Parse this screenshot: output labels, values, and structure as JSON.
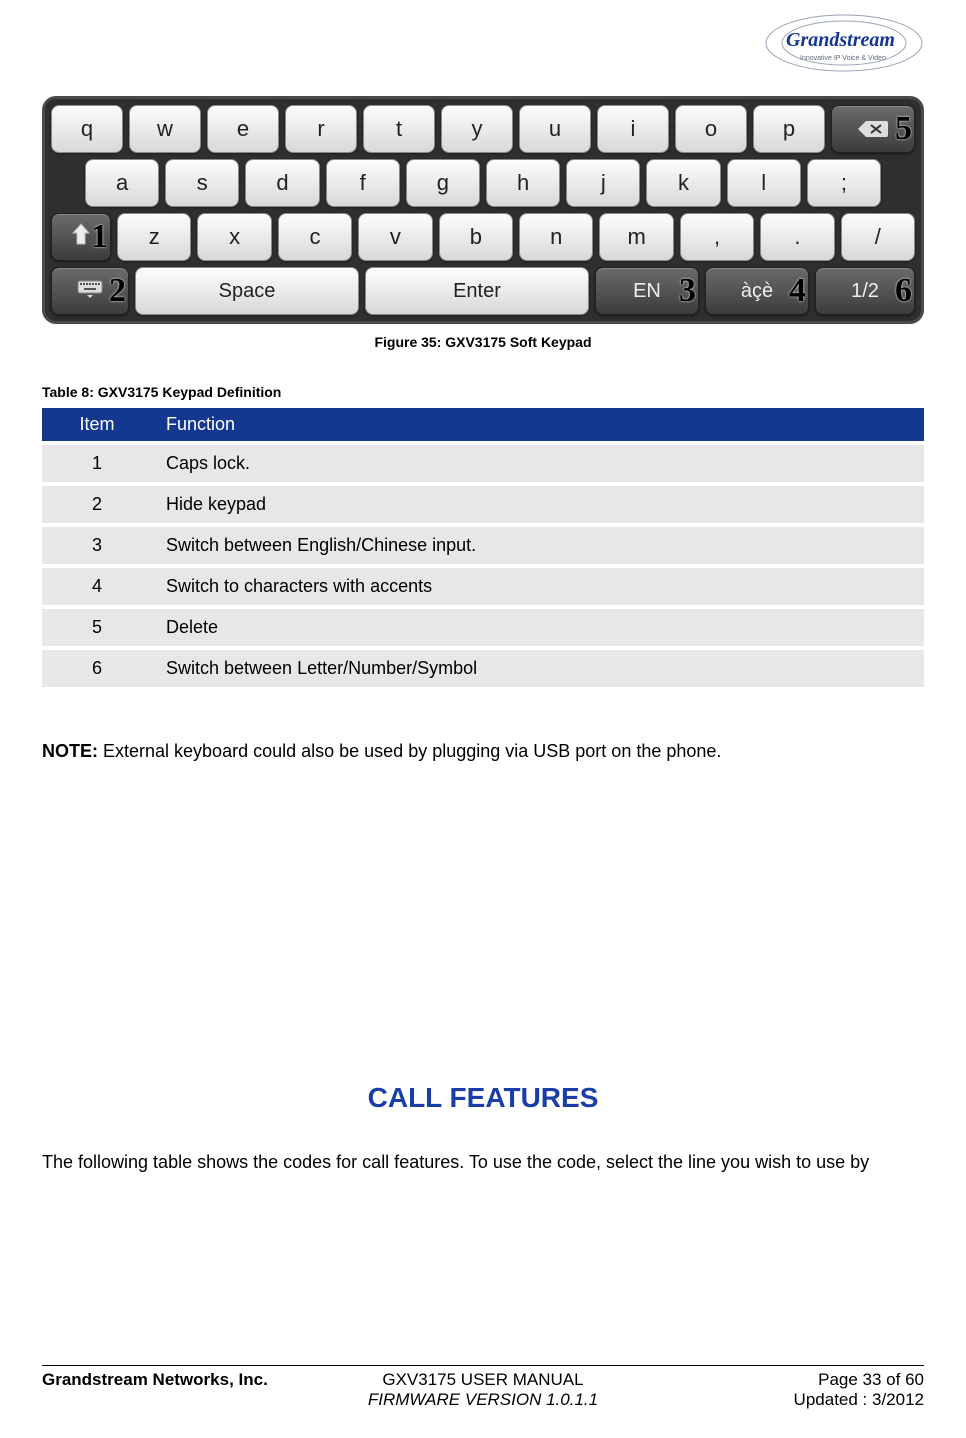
{
  "logo": {
    "brand": "Grandstream",
    "tagline": "Innovative IP Voice & Video"
  },
  "keypad": {
    "row1": [
      "q",
      "w",
      "e",
      "r",
      "t",
      "y",
      "u",
      "i",
      "o",
      "p"
    ],
    "row2": [
      "a",
      "s",
      "d",
      "f",
      "g",
      "h",
      "j",
      "k",
      "l",
      ";"
    ],
    "row3": [
      "z",
      "x",
      "c",
      "v",
      "b",
      "n",
      "m",
      ",",
      ".",
      "/"
    ],
    "space": "Space",
    "enter": "Enter",
    "en": "EN",
    "accents": "àçè",
    "mode": "1/2",
    "badges": {
      "shift": "1",
      "hide": "2",
      "en": "3",
      "accents": "4",
      "backspace": "5",
      "mode": "6"
    }
  },
  "figure_caption": "Figure 35: GXV3175 Soft Keypad",
  "table_caption": "Table 8: GXV3175 Keypad Definition",
  "table": {
    "headers": {
      "item": "Item",
      "function": "Function"
    },
    "rows": [
      {
        "item": "1",
        "function": "Caps lock."
      },
      {
        "item": "2",
        "function": "Hide keypad"
      },
      {
        "item": "3",
        "function": "Switch between English/Chinese input."
      },
      {
        "item": "4",
        "function": "Switch to characters with accents"
      },
      {
        "item": "5",
        "function": "Delete"
      },
      {
        "item": "6",
        "function": "Switch between Letter/Number/Symbol"
      }
    ]
  },
  "note": {
    "label": "NOTE:",
    "text": " External keyboard could also be used by plugging via USB port on the phone."
  },
  "section_title": "CALL FEATURES",
  "body_para": "The following table shows the codes for call features. To use the code, select the line you wish to use by",
  "footer": {
    "company": "Grandstream Networks, Inc.",
    "manual": "GXV3175 USER MANUAL",
    "page": "Page 33 of 60",
    "firmware": "FIRMWARE VERSION 1.0.1.1",
    "updated": "Updated : 3/2012"
  }
}
